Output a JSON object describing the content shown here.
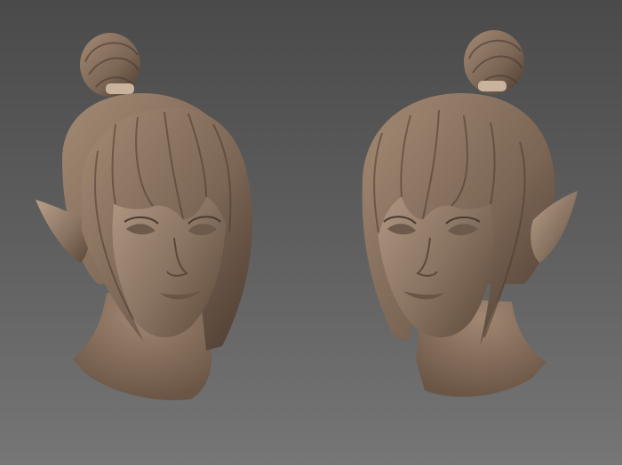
{
  "scene": {
    "background_top": "#4a4a4a",
    "background_bottom": "#767676",
    "material_base": "#8a7462",
    "material_light": "#b9a08a",
    "material_shadow": "#4b3b30",
    "hair_tie_color": "#c9b39c"
  },
  "views": [
    {
      "name": "three-quarter-left",
      "icon": "sculpt-head-icon"
    },
    {
      "name": "three-quarter-right",
      "icon": "sculpt-head-icon"
    }
  ]
}
